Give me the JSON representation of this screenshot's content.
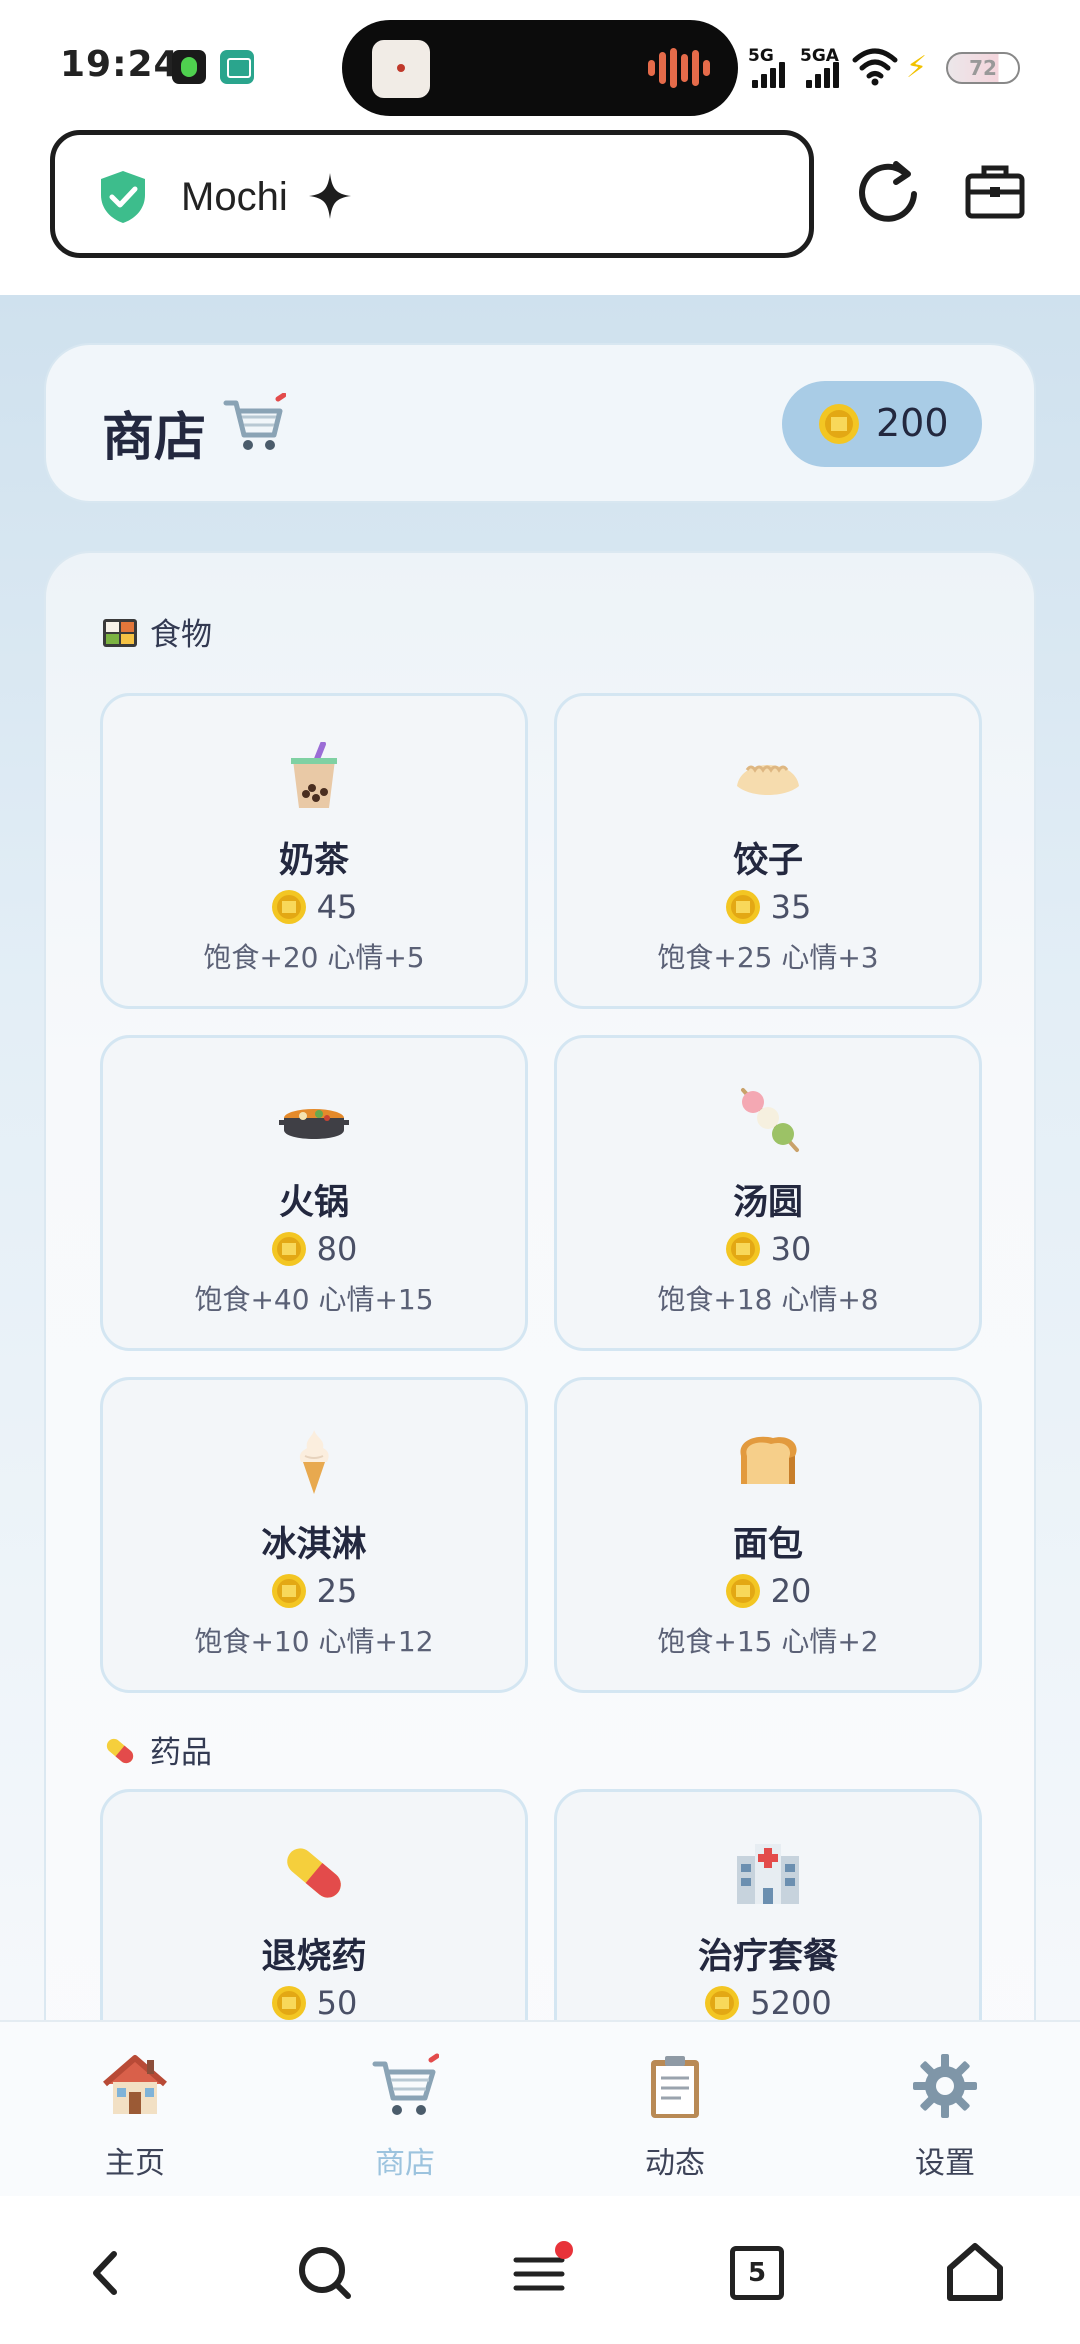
{
  "status_bar": {
    "time": "19:24",
    "signal_1": "5G",
    "signal_2": "5GA",
    "battery": "72"
  },
  "browser": {
    "url_text": "Mochi",
    "tab_count": "5"
  },
  "shop": {
    "title": "商店",
    "coins": "200"
  },
  "sections": [
    {
      "label": "食物",
      "icon": "bento-icon"
    },
    {
      "label": "药品",
      "icon": "pill-icon"
    }
  ],
  "items": [
    {
      "name": "奶茶",
      "price": "45",
      "effect": "饱食+20 心情+5",
      "icon": "bubble-tea-icon"
    },
    {
      "name": "饺子",
      "price": "35",
      "effect": "饱食+25 心情+3",
      "icon": "dumpling-icon"
    },
    {
      "name": "火锅",
      "price": "80",
      "effect": "饱食+40 心情+15",
      "icon": "hotpot-icon"
    },
    {
      "name": "汤圆",
      "price": "30",
      "effect": "饱食+18 心情+8",
      "icon": "dango-icon"
    },
    {
      "name": "冰淇淋",
      "price": "25",
      "effect": "饱食+10 心情+12",
      "icon": "ice-cream-icon"
    },
    {
      "name": "面包",
      "price": "20",
      "effect": "饱食+15 心情+2",
      "icon": "bread-icon"
    },
    {
      "name": "退烧药",
      "price": "50",
      "effect": "",
      "icon": "pill-icon"
    },
    {
      "name": "治疗套餐",
      "price": "5200",
      "effect": "",
      "icon": "hospital-icon"
    }
  ],
  "tabs": [
    {
      "label": "主页",
      "icon": "house-icon"
    },
    {
      "label": "商店",
      "icon": "cart-icon",
      "active": true
    },
    {
      "label": "动态",
      "icon": "clipboard-icon"
    },
    {
      "label": "设置",
      "icon": "gear-icon"
    }
  ],
  "colors": {
    "accent": "#9cc3de",
    "coin_pill": "#a9cce6",
    "text_dark": "#23283f"
  }
}
